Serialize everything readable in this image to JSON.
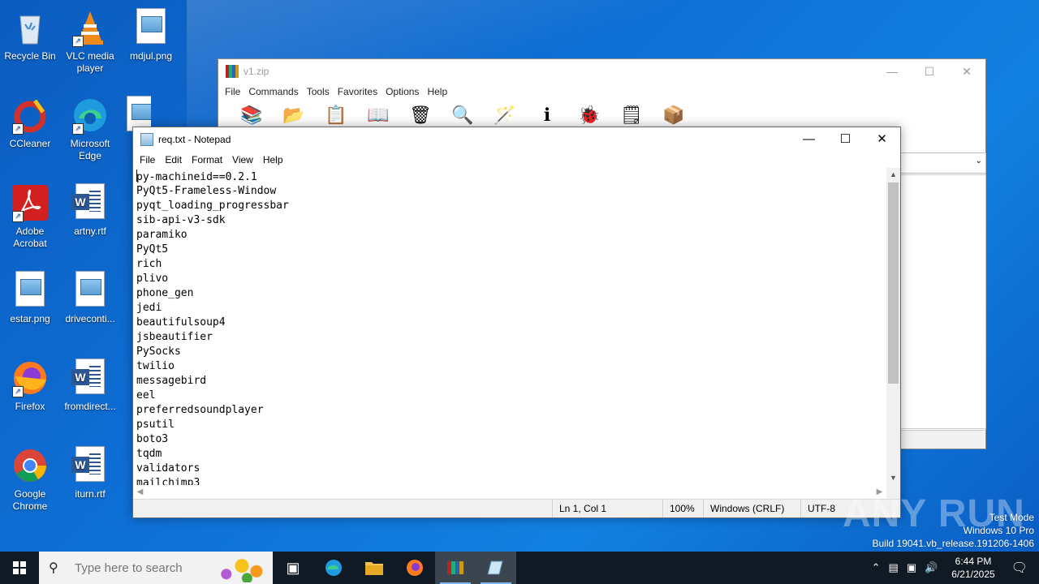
{
  "desktop": {
    "icons": [
      {
        "label": "Recycle Bin"
      },
      {
        "label": "VLC media player"
      },
      {
        "label": "mdjul.png"
      },
      {
        "label": "CCleaner"
      },
      {
        "label": "Microsoft Edge"
      },
      {
        "label": "Adobe Acrobat"
      },
      {
        "label": "artny.rtf"
      },
      {
        "label": "estar.png"
      },
      {
        "label": "driveconti..."
      },
      {
        "label": "Firefox"
      },
      {
        "label": "fromdirect..."
      },
      {
        "label": "Google Chrome"
      },
      {
        "label": "iturn.rtf"
      }
    ]
  },
  "winrar": {
    "title": "v1.zip",
    "menu": [
      "File",
      "Commands",
      "Tools",
      "Favorites",
      "Options",
      "Help"
    ]
  },
  "notepad": {
    "title": "req.txt - Notepad",
    "menu": [
      "File",
      "Edit",
      "Format",
      "View",
      "Help"
    ],
    "lines": [
      "py-machineid==0.2.1",
      "PyQt5-Frameless-Window",
      "pyqt_loading_progressbar",
      "sib-api-v3-sdk",
      "paramiko",
      "PyQt5",
      "rich",
      "plivo",
      "phone_gen",
      "jedi",
      "beautifulsoup4",
      "jsbeautifier",
      "PySocks",
      "twilio",
      "messagebird",
      "eel",
      "preferredsoundplayer",
      "psutil",
      "boto3",
      "tqdm",
      "validators",
      "mailchimp3"
    ],
    "status": {
      "position": "Ln 1, Col 1",
      "zoom": "100%",
      "line_ending": "Windows (CRLF)",
      "encoding": "UTF-8"
    }
  },
  "watermark": {
    "brand": "ANY RUN",
    "mode": "Test Mode",
    "edition": "Windows 10 Pro",
    "build": "Build 19041.vb_release.191206-1406"
  },
  "taskbar": {
    "search_placeholder": "Type here to search",
    "time": "6:44 PM",
    "date": "6/21/2025"
  }
}
